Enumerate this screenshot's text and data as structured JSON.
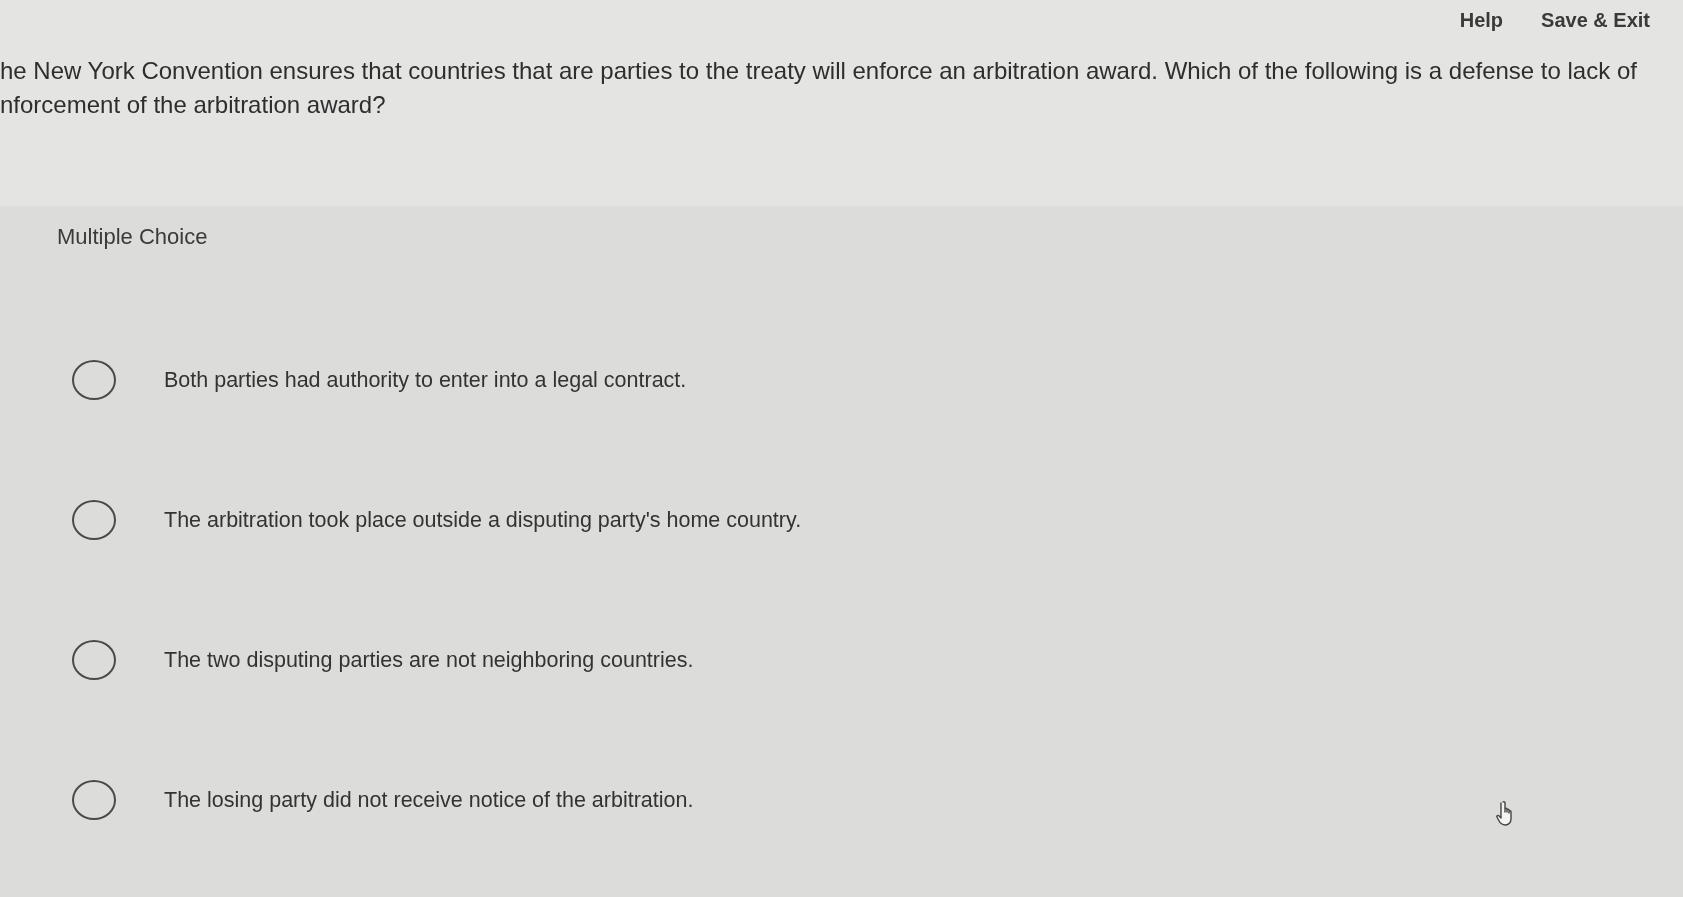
{
  "header": {
    "links": [
      "Help",
      "Save & Exit"
    ]
  },
  "question": {
    "lines": [
      "he New York Convention ensures that countries that are parties to the treaty will enforce an arbitration award. Which of the following is a defense to lack of",
      "nforcement of the arbitration award?"
    ]
  },
  "answer_panel": {
    "type_label": "Multiple Choice",
    "options": [
      {
        "label": "Both parties had authority to enter into a legal contract.",
        "selected": false
      },
      {
        "label": "The arbitration took place outside a disputing party's home country.",
        "selected": false
      },
      {
        "label": "The two disputing parties are not neighboring countries.",
        "selected": false
      },
      {
        "label": "The losing party did not receive notice of the arbitration.",
        "selected": false
      }
    ]
  }
}
